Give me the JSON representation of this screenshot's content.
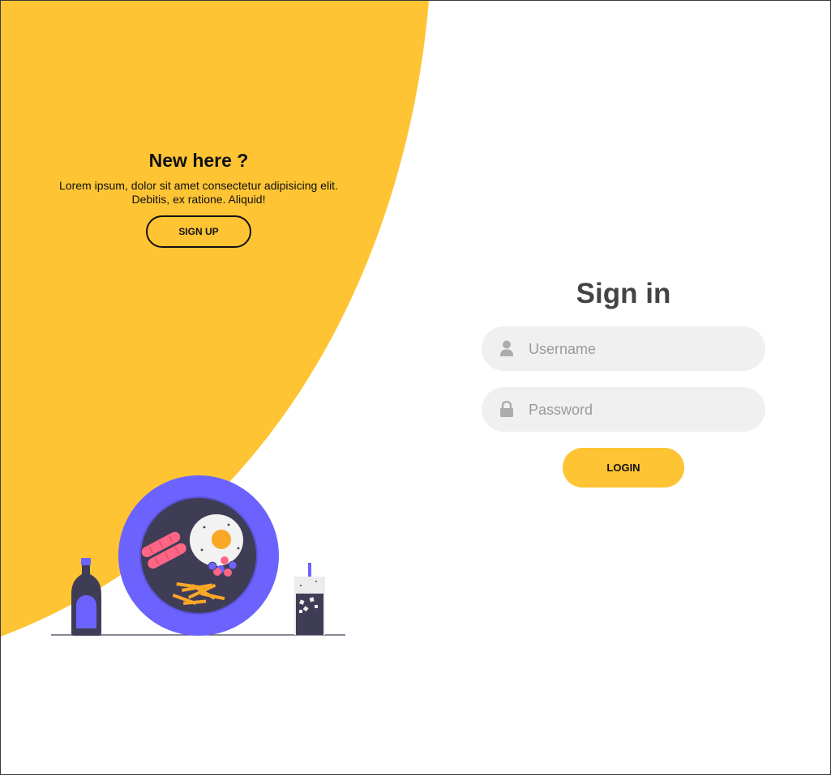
{
  "theme": {
    "accent": "#fec434",
    "plate": "#6c63ff",
    "dark": "#3f3d56"
  },
  "left_panel": {
    "title": "New here ?",
    "text": "Lorem ipsum, dolor sit amet consectetur adipisicing elit. Debitis, ex ratione. Aliquid!",
    "signup_label": "SIGN UP"
  },
  "sign_in": {
    "title": "Sign in",
    "username_placeholder": "Username",
    "password_placeholder": "Password",
    "login_label": "LOGIN"
  },
  "icons": {
    "username": "user-icon",
    "password": "lock-icon"
  }
}
